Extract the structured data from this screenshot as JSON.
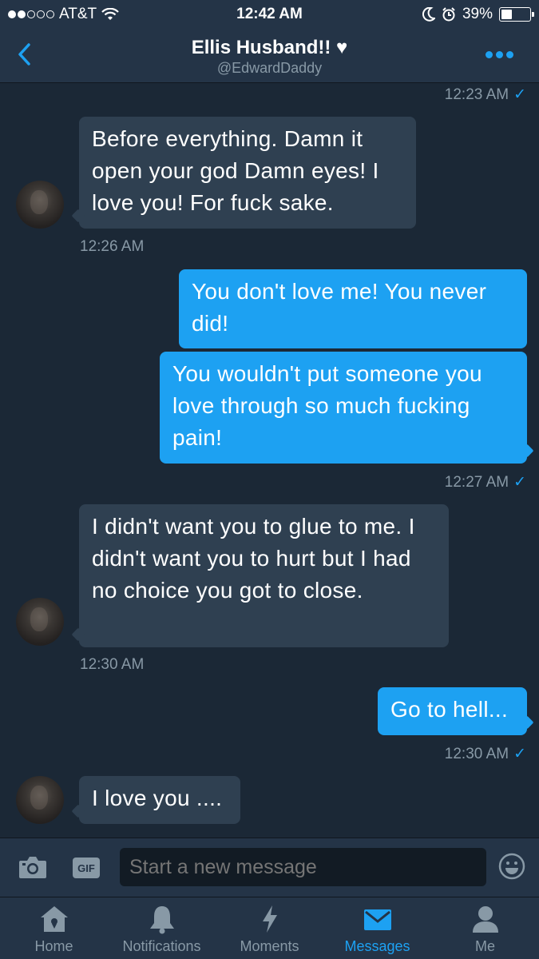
{
  "status_bar": {
    "carrier": "AT&T",
    "time": "12:42 AM",
    "battery": "39%",
    "battery_level": 0.39,
    "signal_bars": 2,
    "signal_max": 5
  },
  "header": {
    "title": "Ellis Husband!! ♥",
    "handle": "@EdwardDaddy",
    "back_icon": "chevron-left-icon",
    "more_icon": "more-dots-icon"
  },
  "messages": [
    {
      "type": "timestamp",
      "side": "out",
      "text": "12:23 AM",
      "read": true
    },
    {
      "type": "message",
      "side": "in",
      "text": "Before everything. Damn it open your god Damn eyes! I love you! For fuck sake."
    },
    {
      "type": "timestamp",
      "side": "in",
      "text": "12:26 AM"
    },
    {
      "type": "message",
      "side": "out",
      "text": "You don't love me! You never did!"
    },
    {
      "type": "message",
      "side": "out",
      "text": "You wouldn't put someone you love through so much fucking pain!"
    },
    {
      "type": "timestamp",
      "side": "out",
      "text": "12:27 AM",
      "read": true
    },
    {
      "type": "message",
      "side": "in",
      "text": "I didn't want you to glue to me. I didn't want you to hurt but I had no choice you got to close."
    },
    {
      "type": "timestamp",
      "side": "in",
      "text": "12:30 AM"
    },
    {
      "type": "message",
      "side": "out",
      "text": "Go to hell..."
    },
    {
      "type": "timestamp",
      "side": "out",
      "text": "12:30 AM",
      "read": true
    },
    {
      "type": "message",
      "side": "in",
      "text": "I love you ...."
    }
  ],
  "compose": {
    "placeholder": "Start a new message",
    "gif_label": "GIF",
    "camera_icon": "camera-icon",
    "emoji_icon": "emoji-icon"
  },
  "tabs": [
    {
      "label": "Home",
      "icon": "home-icon",
      "active": false
    },
    {
      "label": "Notifications",
      "icon": "bell-icon",
      "active": false
    },
    {
      "label": "Moments",
      "icon": "lightning-icon",
      "active": false
    },
    {
      "label": "Messages",
      "icon": "envelope-icon",
      "active": true
    },
    {
      "label": "Me",
      "icon": "person-icon",
      "active": false
    }
  ],
  "colors": {
    "background": "#1b2836",
    "bar": "#243447",
    "incoming_bubble": "#2f4051",
    "outgoing_bubble": "#1da1f2",
    "accent": "#1da1f2",
    "muted_text": "#8899a6"
  }
}
